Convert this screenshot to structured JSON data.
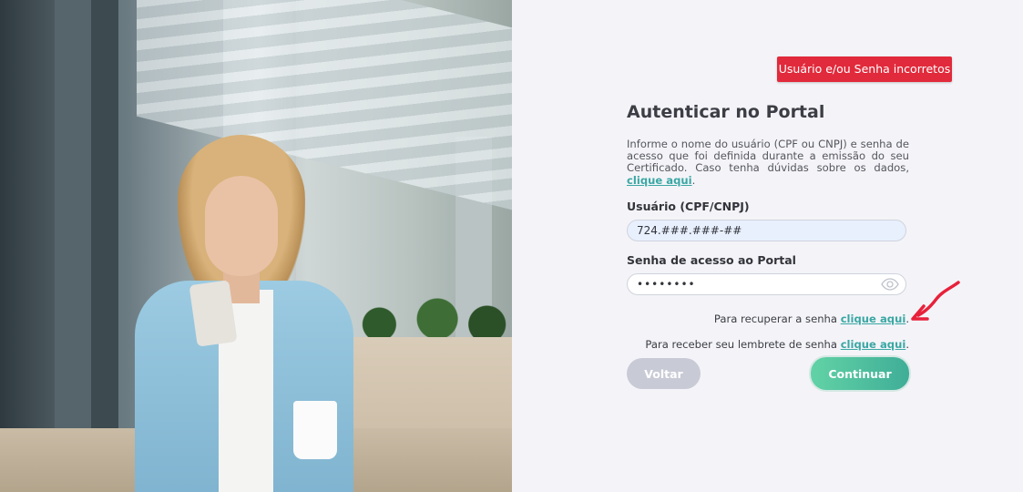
{
  "alert": {
    "text": "Usuário e/ou Senha incorretos"
  },
  "form": {
    "title": "Autenticar no Portal",
    "description": "Informe o nome do usuário (CPF ou CNPJ) e senha de acesso que foi definida durante a emissão do seu Certificado. Caso tenha dúvidas sobre os dados, ",
    "description_link": "clique aqui",
    "description_end": ".",
    "user_label": "Usuário (CPF/CNPJ)",
    "user_value": "724.###.###-##",
    "password_label": "Senha de acesso ao Portal",
    "password_value": "••••••••",
    "recover_text": "Para recuperar a senha ",
    "recover_link": "clique aqui",
    "recover_end": ".",
    "reminder_text": "Para receber seu lembrete de senha ",
    "reminder_link": "clique aqui",
    "reminder_end": ".",
    "back_label": "Voltar",
    "continue_label": "Continuar"
  },
  "icons": {
    "password_toggle": "eye-icon",
    "annotation": "red-arrow-icon"
  },
  "colors": {
    "alert": "#e12a3b",
    "link": "#3aa7a4",
    "continue_start": "#62d2a6",
    "continue_end": "#3fae97",
    "back": "#c8cad6",
    "annotation_arrow": "#e8213b"
  }
}
